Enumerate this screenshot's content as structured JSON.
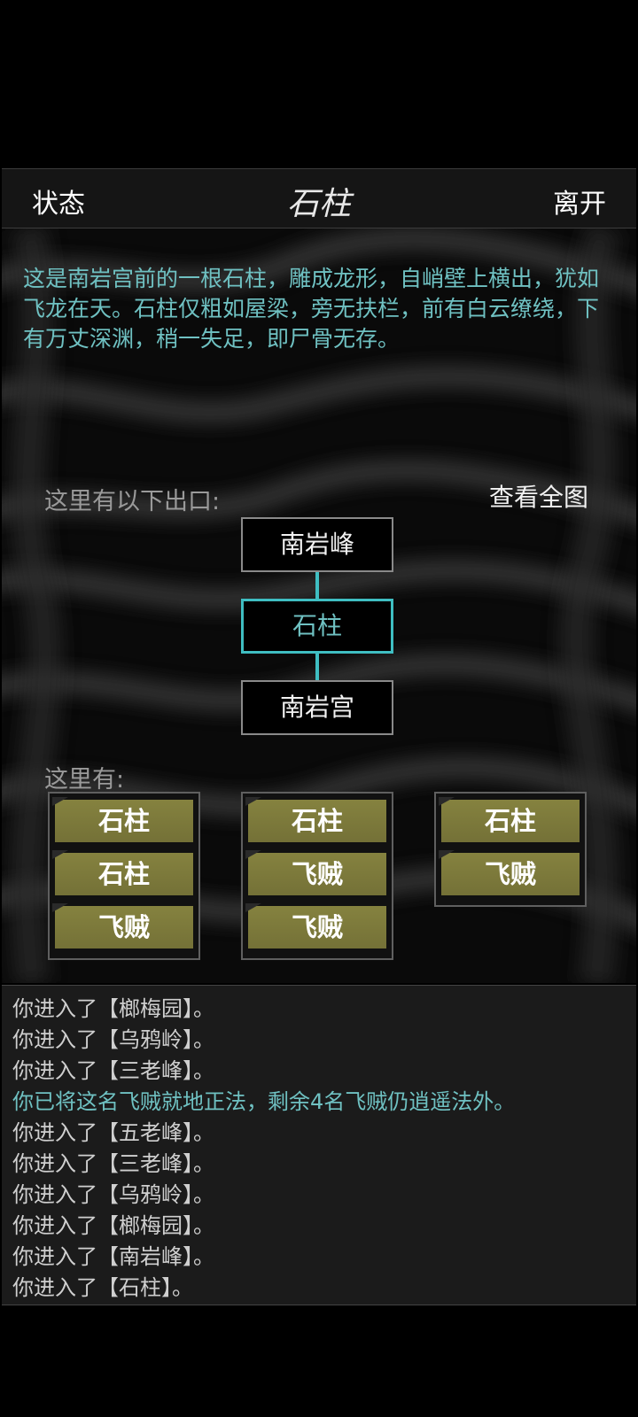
{
  "header": {
    "status_label": "状态",
    "title": "石柱",
    "leave_label": "离开"
  },
  "description": "这是南岩宫前的一根石柱，雕成龙形，自峭壁上横出，犹如飞龙在天。石柱仅粗如屋梁，旁无扶栏，前有白云缭绕，下有万丈深渊，稍一失足，即尸骨无存。",
  "exits": {
    "label": "这里有以下出口:",
    "view_map_label": "查看全图",
    "north": "南岩峰",
    "current": "石柱",
    "south": "南岩宫"
  },
  "here": {
    "label": "这里有:",
    "groups": [
      [
        "石柱",
        "石柱",
        "飞贼"
      ],
      [
        "石柱",
        "飞贼",
        "飞贼"
      ],
      [
        "石柱",
        "飞贼"
      ]
    ]
  },
  "log": [
    {
      "text": "你进入了【榔梅园】。",
      "highlight": false
    },
    {
      "text": "你进入了【乌鸦岭】。",
      "highlight": false
    },
    {
      "text": "你进入了【三老峰】。",
      "highlight": false
    },
    {
      "text": "你已将这名飞贼就地正法，剩余4名飞贼仍逍遥法外。",
      "highlight": true
    },
    {
      "text": "你进入了【五老峰】。",
      "highlight": false
    },
    {
      "text": "你进入了【三老峰】。",
      "highlight": false
    },
    {
      "text": "你进入了【乌鸦岭】。",
      "highlight": false
    },
    {
      "text": "你进入了【榔梅园】。",
      "highlight": false
    },
    {
      "text": "你进入了【南岩峰】。",
      "highlight": false
    },
    {
      "text": "你进入了【石柱】。",
      "highlight": false
    }
  ]
}
